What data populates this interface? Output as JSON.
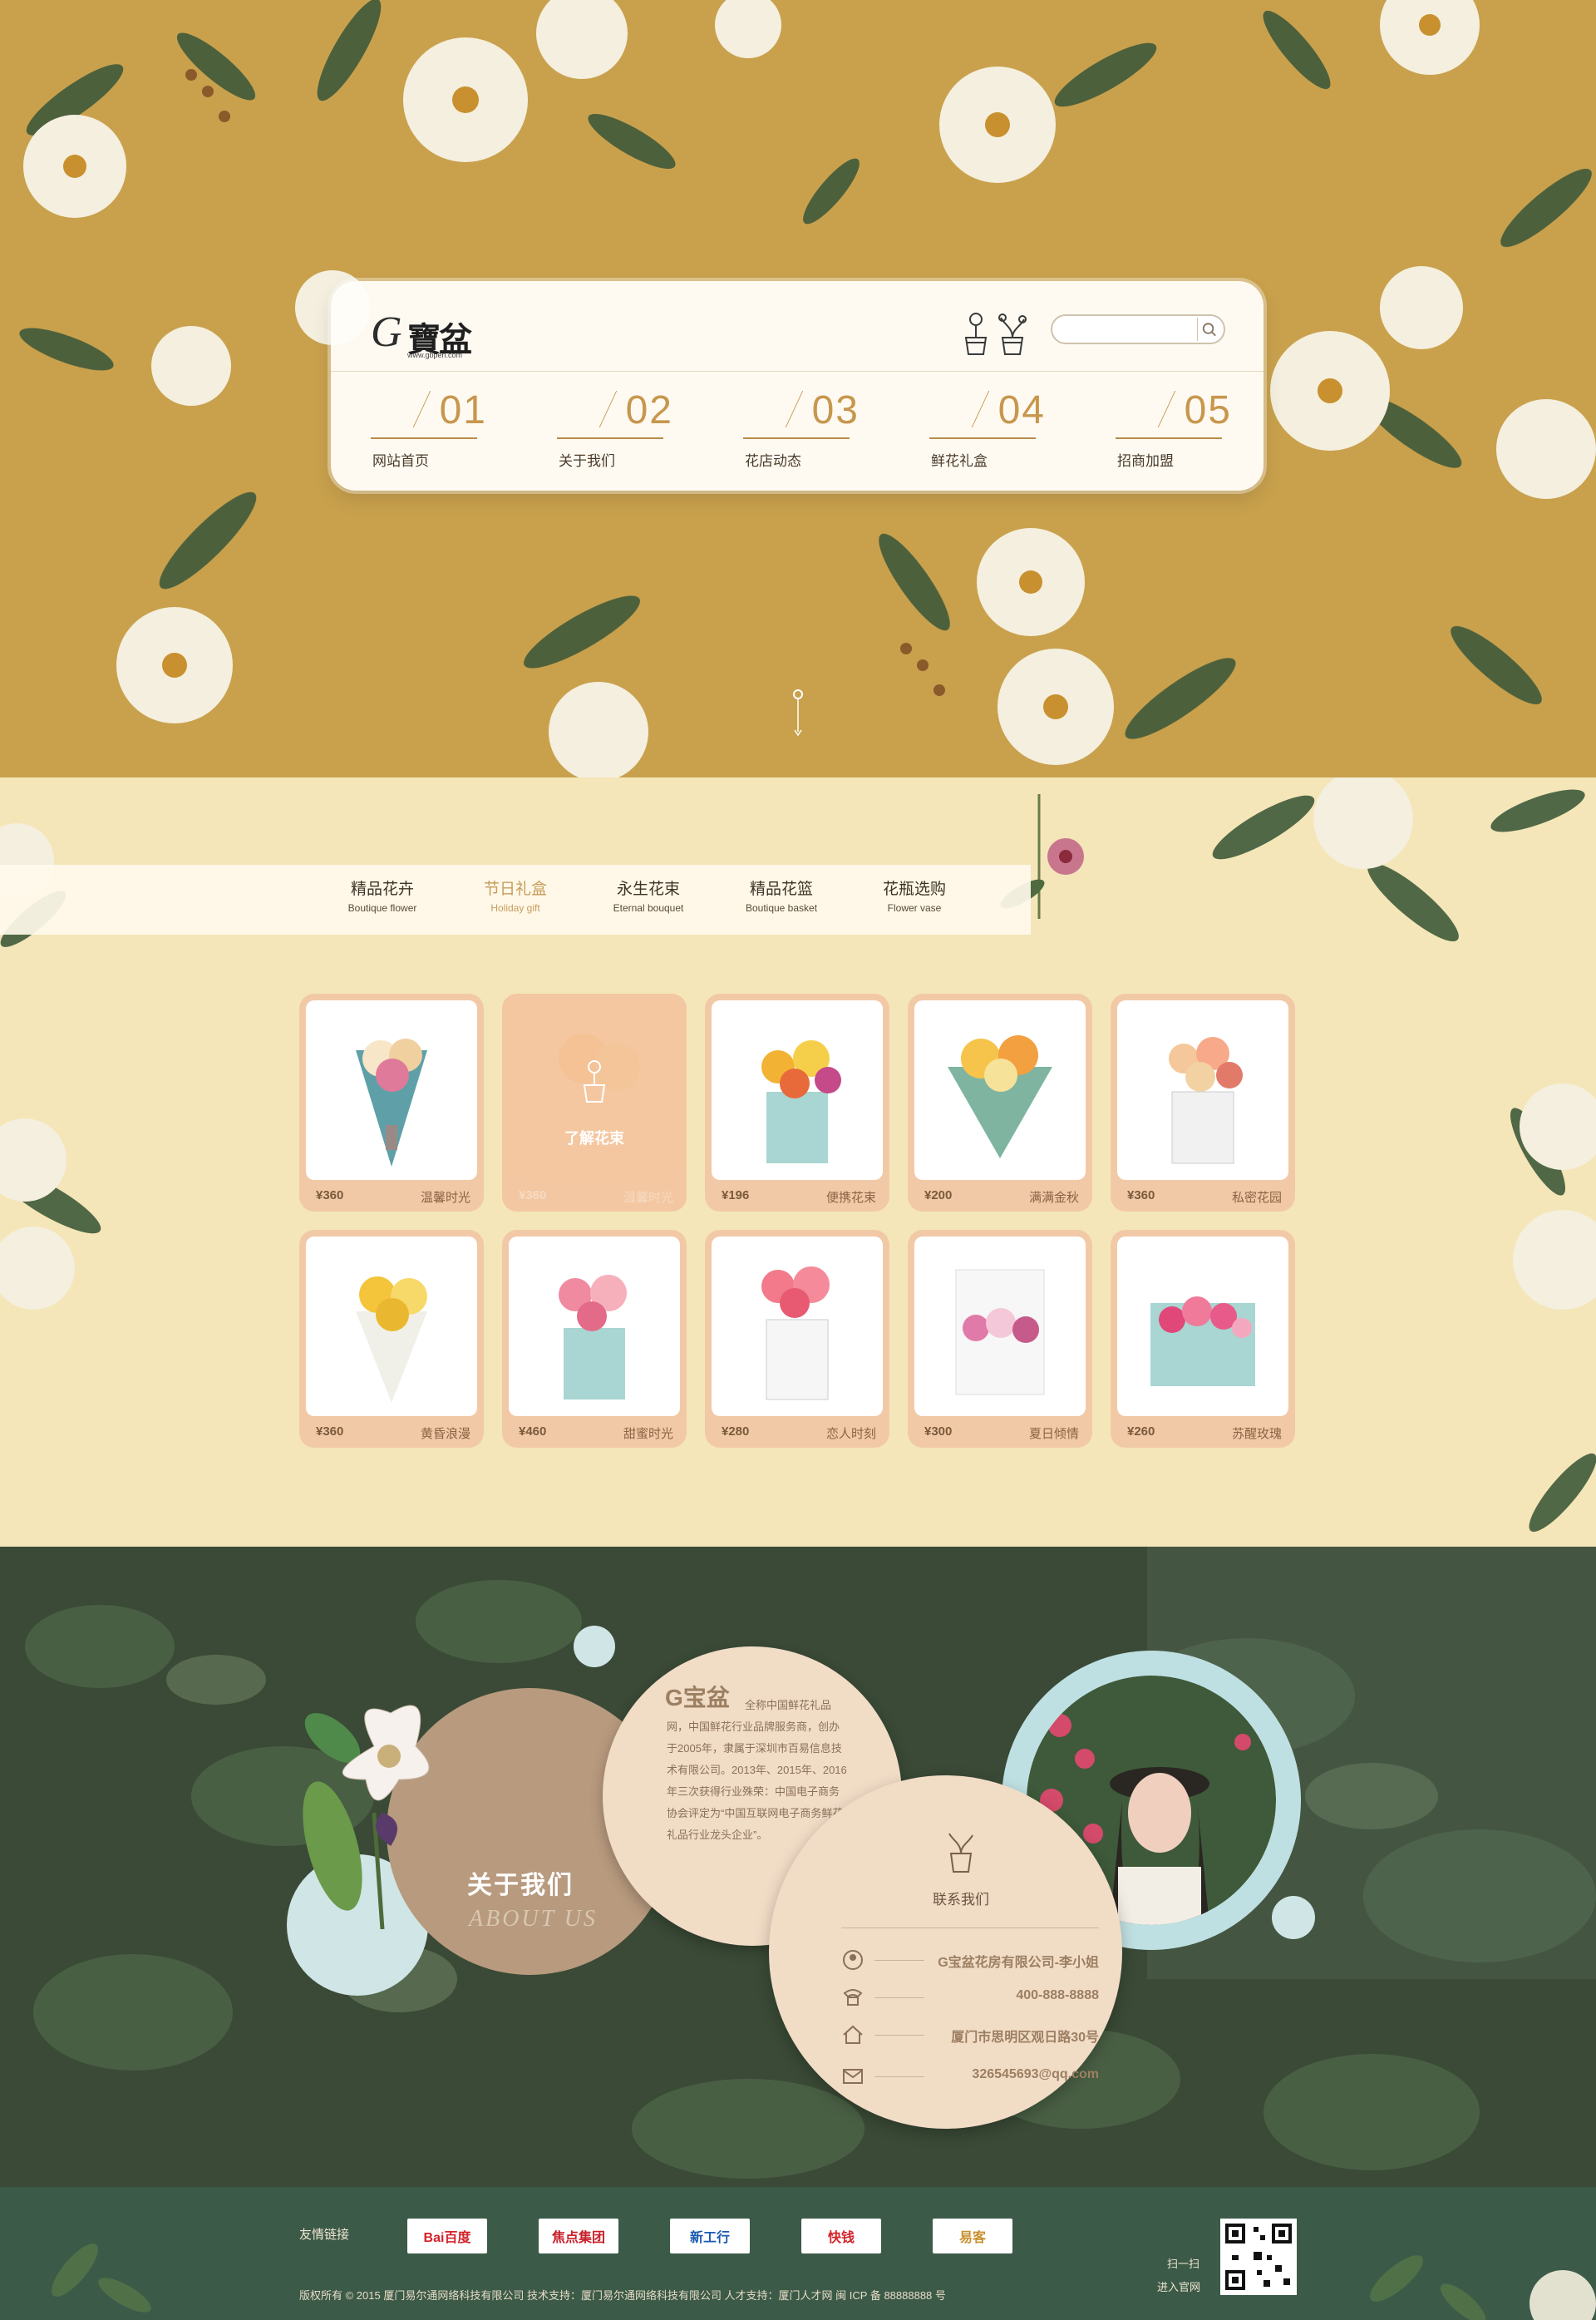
{
  "brand": {
    "logo_letter": "G",
    "logo_cn": "寶盆",
    "logo_url": "www.gbpen.com"
  },
  "search": {
    "placeholder": ""
  },
  "nav": [
    {
      "num": "01",
      "label": "网站首页"
    },
    {
      "num": "02",
      "label": "关于我们"
    },
    {
      "num": "03",
      "label": "花店动态"
    },
    {
      "num": "04",
      "label": "鲜花礼盒"
    },
    {
      "num": "05",
      "label": "招商加盟"
    }
  ],
  "tabs": [
    {
      "cn": "精品花卉",
      "en": "Boutique flower"
    },
    {
      "cn": "节日礼盒",
      "en": "Holiday gift"
    },
    {
      "cn": "永生花束",
      "en": "Eternal bouquet"
    },
    {
      "cn": "精品花篮",
      "en": "Boutique basket"
    },
    {
      "cn": "花瓶选购",
      "en": "Flower vase"
    }
  ],
  "products": [
    {
      "price": "¥360",
      "name": "温馨时光"
    },
    {
      "price": "¥360",
      "name": "温馨时光",
      "overlay": "了解花束"
    },
    {
      "price": "¥196",
      "name": "便携花束"
    },
    {
      "price": "¥200",
      "name": "满满金秋"
    },
    {
      "price": "¥360",
      "name": "私密花园"
    },
    {
      "price": "¥360",
      "name": "黄昏浪漫"
    },
    {
      "price": "¥460",
      "name": "甜蜜时光"
    },
    {
      "price": "¥280",
      "name": "恋人时刻"
    },
    {
      "price": "¥300",
      "name": "夏日倾情"
    },
    {
      "price": "¥260",
      "name": "苏醒玫瑰"
    }
  ],
  "about": {
    "title": "关于我们",
    "subtitle": "ABOUT US",
    "intro_title": "G宝盆",
    "intro_lead": "全称中国鲜花礼品",
    "intro_body": "网，中国鲜花行业品牌服务商，创办于2005年，隶属于深圳市百易信息技术有限公司。2013年、2015年、2016年三次获得行业殊荣：中国电子商务协会评定为“中国互联网电子商务鲜花礼品行业龙头企业”。",
    "contact_head": "联系我们",
    "contacts": [
      {
        "icon": "person-icon",
        "text": "G宝盆花房有限公司-李小姐"
      },
      {
        "icon": "phone-icon",
        "text": "400-888-8888"
      },
      {
        "icon": "home-icon",
        "text": "厦门市思明区观日路30号"
      },
      {
        "icon": "mail-icon",
        "text": "326545693@qq.com"
      }
    ]
  },
  "footer": {
    "links_label": "友情链接",
    "partners": [
      "Bai百度",
      "焦点集团",
      "新工行",
      "快钱",
      "易客"
    ],
    "copyright": "版权所有 © 2015 厦门易尔通网络科技有限公司   技术支持：厦门易尔通网络科技有限公司   人才支持：厦门人才网 闽 ICP 备 88888888 号",
    "qr_scan": "扫一扫",
    "qr_go": "进入官网"
  },
  "colors": {
    "hero_bg": "#c9a14d",
    "products_bg": "#f4e6b8",
    "card": "#f2c9a6",
    "footer": "#3c5a48",
    "accent": "#c7974d"
  }
}
